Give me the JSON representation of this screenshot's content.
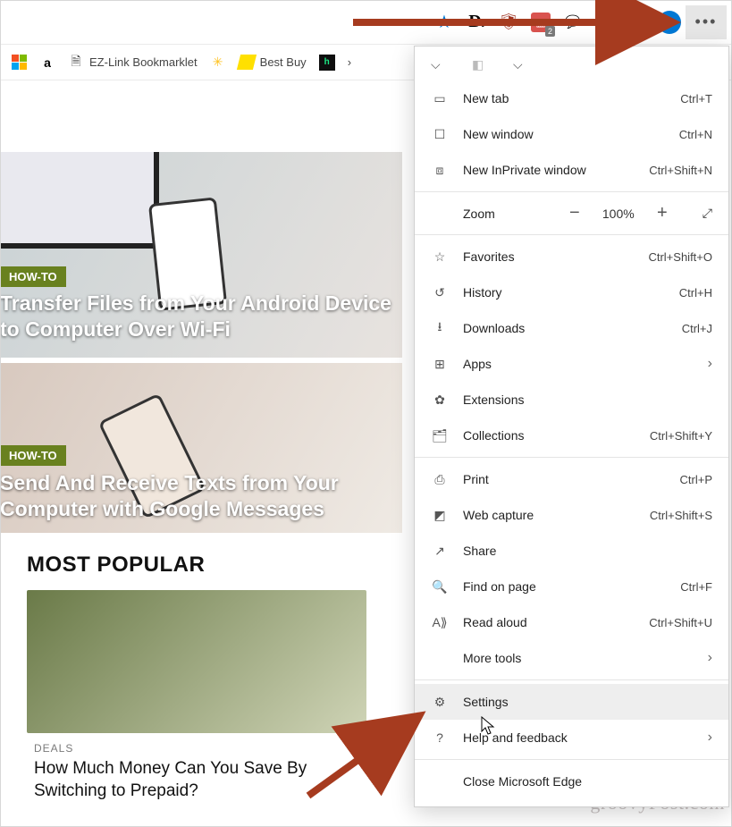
{
  "toolbar": {
    "badge_count": "2"
  },
  "bookmarks": {
    "ezlink": "EZ-Link Bookmarklet",
    "bestbuy": "Best Buy"
  },
  "content": {
    "badge_howto": "HOW-TO",
    "hero1_title": "Transfer Files from Your Android Device to Computer Over Wi-Fi",
    "hero2_title": "Send And Receive Texts from Your Computer with Google Messages",
    "mp_heading": "MOST POPULAR",
    "mp_cat": "DEALS",
    "mp_title": "How Much Money Can You Save By Switching to Prepaid?"
  },
  "menu": {
    "new_tab": {
      "label": "New tab",
      "accel": "Ctrl+T"
    },
    "new_window": {
      "label": "New window",
      "accel": "Ctrl+N"
    },
    "new_inprivate": {
      "label": "New InPrivate window",
      "accel": "Ctrl+Shift+N"
    },
    "zoom_label": "Zoom",
    "zoom_value": "100%",
    "favorites": {
      "label": "Favorites",
      "accel": "Ctrl+Shift+O"
    },
    "history": {
      "label": "History",
      "accel": "Ctrl+H"
    },
    "downloads": {
      "label": "Downloads",
      "accel": "Ctrl+J"
    },
    "apps": {
      "label": "Apps"
    },
    "extensions": {
      "label": "Extensions"
    },
    "collections": {
      "label": "Collections",
      "accel": "Ctrl+Shift+Y"
    },
    "print": {
      "label": "Print",
      "accel": "Ctrl+P"
    },
    "webcapture": {
      "label": "Web capture",
      "accel": "Ctrl+Shift+S"
    },
    "share": {
      "label": "Share"
    },
    "find": {
      "label": "Find on page",
      "accel": "Ctrl+F"
    },
    "read": {
      "label": "Read aloud",
      "accel": "Ctrl+Shift+U"
    },
    "more": {
      "label": "More tools"
    },
    "settings": {
      "label": "Settings"
    },
    "help": {
      "label": "Help and feedback"
    },
    "close": {
      "label": "Close Microsoft Edge"
    }
  },
  "watermark": "groovyPost.com"
}
